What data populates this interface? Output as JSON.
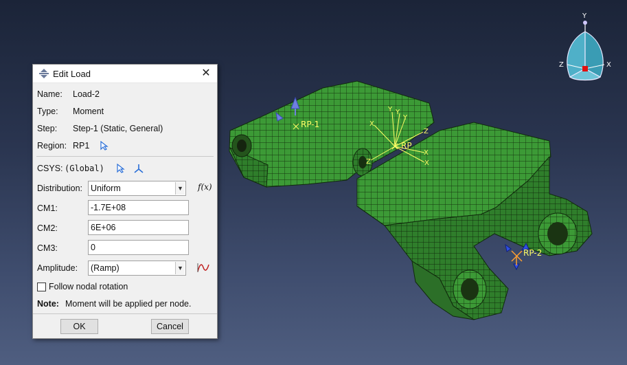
{
  "triad": {
    "y": "Y",
    "z": "Z",
    "x": "X"
  },
  "model": {
    "rp1": "RP-1",
    "rp": "RP",
    "rp2": "RP-2",
    "csys_x1": "X",
    "csys_y1": "Y",
    "csys_y2": "Y",
    "csys_y3": "Y",
    "csys_z1": "Z",
    "csys_x2": "X",
    "csys_x3": "X",
    "csys_z2": "Z"
  },
  "dialog": {
    "title": "Edit Load",
    "name_label": "Name:",
    "name_value": "Load-2",
    "type_label": "Type:",
    "type_value": "Moment",
    "step_label": "Step:",
    "step_value": "Step-1 (Static, General)",
    "region_label": "Region:",
    "region_value": "RP1",
    "csys_label": "CSYS:",
    "csys_value": "(Global)",
    "distribution_label": "Distribution:",
    "distribution_value": "Uniform",
    "fx_label": "f(x)",
    "cm1_label": "CM1:",
    "cm1_value": "-1.7E+08",
    "cm2_label": "CM2:",
    "cm2_value": "6E+06",
    "cm3_label": "CM3:",
    "cm3_value": "0",
    "amplitude_label": "Amplitude:",
    "amplitude_value": "(Ramp)",
    "follow_label": "Follow nodal rotation",
    "follow_checked": false,
    "note_label": "Note:",
    "note_text": "Moment will be applied per node.",
    "ok_label": "OK",
    "cancel_label": "Cancel"
  }
}
